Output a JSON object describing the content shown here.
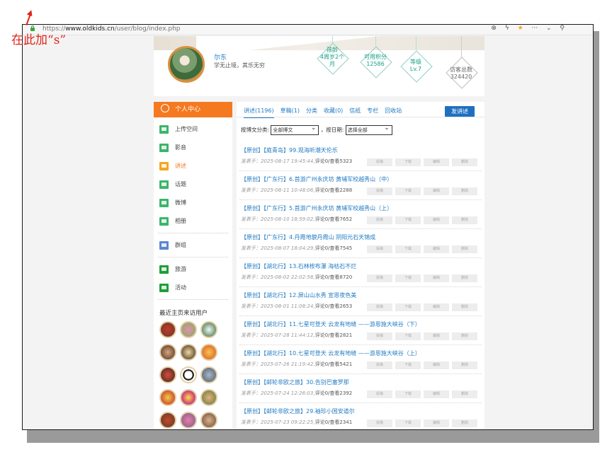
{
  "browser": {
    "url_scheme": "https://",
    "url_domain": "www.oldkids.cn",
    "url_path": "/user/blog/index.php",
    "toolbar_icons": [
      "zoom-icon",
      "bolt-icon",
      "star-icon",
      "more-icon",
      "chevron-down-icon",
      "search-icon"
    ],
    "more_label": "···"
  },
  "annotation": {
    "text": "在此加“s”",
    "color": "#e0251b"
  },
  "profile": {
    "name": "尔东",
    "motto": "学无止境，其乐无穷",
    "stats": [
      {
        "label": "孩龄",
        "value": "4周岁2个月"
      },
      {
        "label": "可用积分",
        "value": "12586"
      },
      {
        "label": "等级",
        "value": "Lv.7"
      },
      {
        "label": "访客总数",
        "value": "324420"
      }
    ]
  },
  "sidebar": {
    "header": "个人中心",
    "items": [
      {
        "label": "上传空间"
      },
      {
        "label": "影音"
      },
      {
        "label": "讲述",
        "active": true
      },
      {
        "label": "话题"
      },
      {
        "label": "微博"
      },
      {
        "label": "相册"
      },
      {
        "label": "群组"
      },
      {
        "label": "旅游"
      },
      {
        "label": "活动"
      }
    ],
    "visitors_title": "最近主页来访用户",
    "accent": "#f47920"
  },
  "main": {
    "tabs": [
      "讲述(1196)",
      "草稿(1)",
      "分类",
      "收藏(0)",
      "信纸",
      "专栏",
      "回收站"
    ],
    "post_button": "发讲述",
    "filter": {
      "category_label": "按博文分类:",
      "category_value": "全部博文",
      "date_label": "，按日期:",
      "date_value": "选择全部"
    },
    "action_labels": [
      "投稿",
      "下载",
      "编辑",
      "删除"
    ],
    "posts": [
      {
        "title": "【原创】【庭青岛】99.观海听潮天伦乐",
        "date": "发表于：2025-08-17 19:45:44,",
        "comments": "评论0",
        "views": "/查看5323"
      },
      {
        "title": "【原创】【广东行】6.首游广州永庆坊 黄埔军校越秀山（中）",
        "date": "发表于：2025-08-11 10:48:06,",
        "comments": "评论0",
        "views": "/查看2288"
      },
      {
        "title": "【原创】【广东行】5.首游广州永庆坊 黄埔军校越秀山（上）",
        "date": "发表于：2025-08-10 18:59:02,",
        "comments": "评论0",
        "views": "/查看7652"
      },
      {
        "title": "【原创】【广东行】4.丹霞地貌丹霞山 阴阳元石天锦成",
        "date": "发表于：2025-08-07 18:04:29,",
        "comments": "评论0",
        "views": "/查看7545"
      },
      {
        "title": "【原创】【湖北行】13.石林桉布瀑 海枯石不烂",
        "date": "发表于：2025-08-02 22:02:58,",
        "comments": "评论0",
        "views": "/查看8720"
      },
      {
        "title": "【原创】【湖北行】12.屏山山水秀 宣恩夜色美",
        "date": "发表于：2025-08-01 11:08:24,",
        "comments": "评论0",
        "views": "/查看2653"
      },
      {
        "title": "【原创】【湖北行】11.七星可登天 云龙有地缝 ——游恩施大峡谷（下）",
        "date": "发表于：2025-07-28 11:44:12,",
        "comments": "评论0",
        "views": "/查看2821"
      },
      {
        "title": "【原创】【湖北行】10.七星可登天 云龙有地缝 ——游恩施大峡谷（上）",
        "date": "发表于：2025-07-26 21:19:42,",
        "comments": "评论0",
        "views": "/查看5421"
      },
      {
        "title": "【原创】【邮轮非欧之旅】30.告别巴塞罗那",
        "date": "发表于：2025-07-24 12:26:03,",
        "comments": "评论0",
        "views": "/查看2392"
      },
      {
        "title": "【原创】【邮轮非欧之旅】29.袖珍小国安道尔",
        "date": "发表于：2025-07-23 09:22:25,",
        "comments": "评论0",
        "views": "/查看2341"
      }
    ]
  }
}
